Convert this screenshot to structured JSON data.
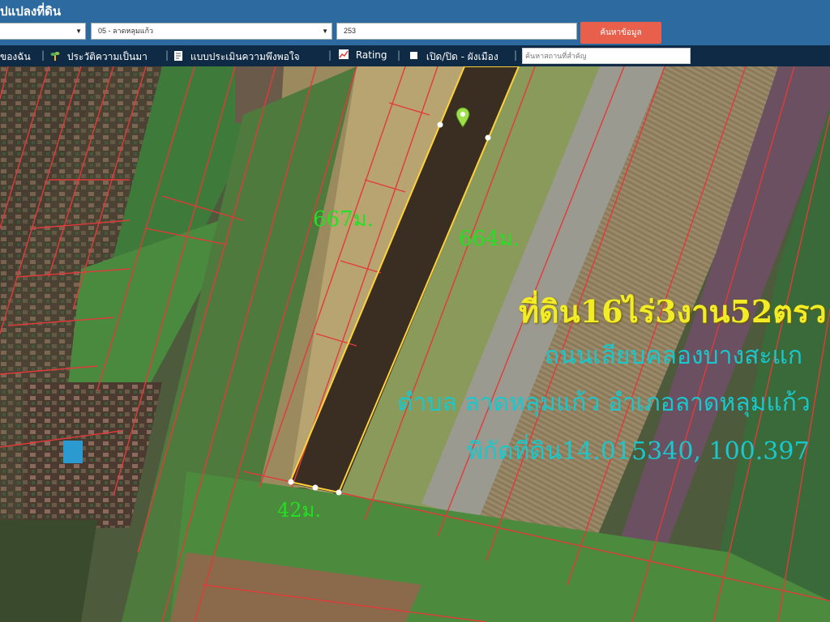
{
  "header": {
    "title": "ปแปลงที่ดิน",
    "district_select": "05 - ลาดหลุมแก้ว",
    "parcel_number": "253",
    "search_button": "ค้นหาข้อมูล"
  },
  "toolbar": {
    "items": [
      {
        "label": "ของฉัน",
        "icon": "bookmark-icon"
      },
      {
        "label": "ประวัติความเป็นมา",
        "icon": "sprout-icon"
      },
      {
        "label": "แบบประเมินความพึงพอใจ",
        "icon": "form-icon"
      },
      {
        "label": "Rating",
        "icon": "chart-icon"
      },
      {
        "label": "เปิด/ปิด - ผังเมือง",
        "icon": "square-icon"
      }
    ],
    "place_search_placeholder": "ค้นหาสถานที่สำคัญ"
  },
  "map": {
    "icon": "location-pin-icon",
    "dim_left": "667ม.",
    "dim_right": "664ม.",
    "dim_bottom": "42ม.",
    "info_area": "ที่ดิน16ไร่3งาน52ตรว",
    "info_road": "ถนนเลียบคลองบางสะแก",
    "info_location": "ตำบล ลาดหลุมแก้ว อำเภอลาดหลุมแก้ว",
    "info_coords": "พิกัดที่ดิน14.015340, 100.397"
  },
  "colors": {
    "header_bg": "#2d6aa0",
    "toolbar_bg": "#0f2a44",
    "button_bg": "#e8604c",
    "parcel_line": "#e23a3a",
    "highlight_line": "#ffd23a",
    "dimension_text": "#22e022",
    "info_title": "#f2ec26",
    "info_text": "#18c8cc"
  }
}
